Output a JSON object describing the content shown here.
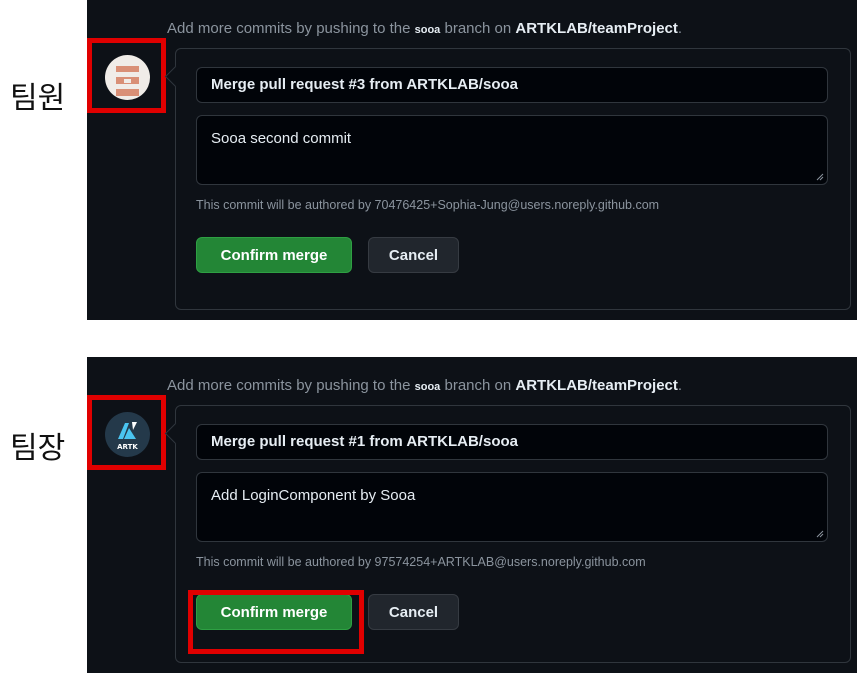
{
  "panels": [
    {
      "role_label": "팀원",
      "hint": {
        "prefix": "Add more commits by pushing to the ",
        "branch": "sooa",
        "middle": " branch on ",
        "repo": "ARTKLAB/teamProject",
        "suffix": "."
      },
      "avatar": {
        "type": "pixel-face",
        "colors": {
          "bg": "#f0ece8",
          "accent": "#d98f76"
        }
      },
      "merge_title": "Merge pull request #3 from ARTKLAB/sooa",
      "merge_body": "Sooa second commit",
      "author_note": "This commit will be authored by 70476425+Sophia-Jung@users.noreply.github.com",
      "confirm_label": "Confirm merge",
      "cancel_label": "Cancel"
    },
    {
      "role_label": "팀장",
      "hint": {
        "prefix": "Add more commits by pushing to the ",
        "branch": "sooa",
        "middle": " branch on ",
        "repo": "ARTKLAB/teamProject",
        "suffix": "."
      },
      "avatar": {
        "type": "artk-logo",
        "logo_text": "ARTK",
        "colors": {
          "bg": "#24394a",
          "accent": "#4ac4f0"
        }
      },
      "merge_title": "Merge pull request #1 from ARTKLAB/sooa",
      "merge_body": "Add LoginComponent by Sooa",
      "author_note": "This commit will be authored by 97574254+ARTKLAB@users.noreply.github.com",
      "confirm_label": "Confirm merge",
      "cancel_label": "Cancel"
    }
  ],
  "theme": {
    "panel_bg": "#0d1117",
    "input_bg": "#010409",
    "border": "#30363d",
    "muted": "#8b949e",
    "text": "#e6edf3",
    "primary": "#238636",
    "highlight": "#e00000"
  }
}
